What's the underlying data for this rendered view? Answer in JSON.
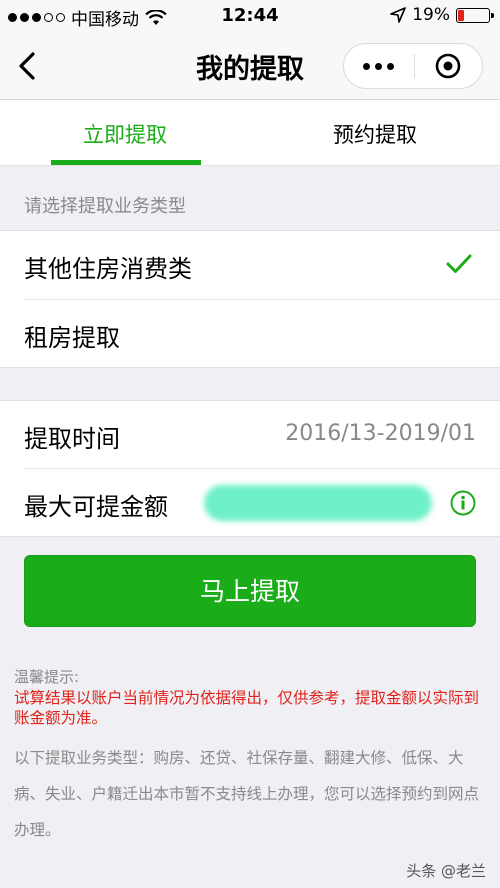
{
  "status_bar": {
    "carrier": "中国移动",
    "time": "12:44",
    "battery_percent": "19%",
    "battery_level": 0.19,
    "battery_color": "#e0231b",
    "icons": [
      "signal-dots-icon",
      "wifi-icon",
      "location-arrow-icon",
      "battery-icon"
    ]
  },
  "nav": {
    "title": "我的提取",
    "icons": [
      "back-chevron-icon",
      "more-dots-icon",
      "close-target-icon"
    ]
  },
  "tabs": [
    {
      "label": "立即提取",
      "active": true
    },
    {
      "label": "预约提取",
      "active": false
    }
  ],
  "accent_color": "#1aad19",
  "business": {
    "section_label": "请选择提取业务类型",
    "options": [
      {
        "label": "其他住房消费类",
        "selected": true
      },
      {
        "label": "租房提取",
        "selected": false
      }
    ]
  },
  "details": {
    "time_label": "提取时间",
    "time_value": "2016/13-2019/01",
    "max_amount_label": "最大可提金额"
  },
  "action": {
    "button_label": "马上提取"
  },
  "tips": {
    "title": "温馨提示:",
    "warning": "试算结果以账户当前情况为依据得出，仅供参考，提取金额以实际到账金额为准。",
    "body": "以下提取业务类型：购房、还贷、社保存量、翻建大修、低保、大病、失业、户籍迁出本市暂不支持线上办理，您可以选择预约到网点办理。"
  },
  "watermark": "头条 @老兰"
}
